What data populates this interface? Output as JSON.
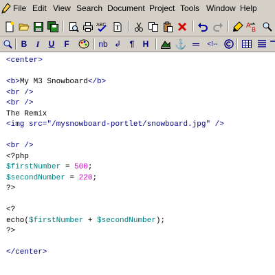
{
  "menu": [
    "File",
    "Edit",
    "View",
    "Search",
    "Document",
    "Project",
    "Tools",
    "Window",
    "Help"
  ],
  "toolbar_icons": [
    "new-file-icon",
    "open-folder-icon",
    "save-icon",
    "save-all-icon",
    "print-preview-icon",
    "print-icon",
    "spellcheck-icon",
    "file-info-icon",
    "cut-icon",
    "copy-icon",
    "paste-icon",
    "delete-icon",
    "undo-icon",
    "redo-icon",
    "highlighter-icon",
    "find-replace-icon",
    "find-icon"
  ],
  "format_toolbar": {
    "bold": "B",
    "italic": "I",
    "underline": "U",
    "font": "F",
    "nbsp": "nb",
    "break": "↲",
    "paragraph": "¶",
    "heading": "H",
    "anchor": "⚓",
    "hr": "═",
    "comment": "<!--"
  },
  "code_lines": [
    {
      "parts": [
        {
          "t": "<center>",
          "c": "tag"
        }
      ]
    },
    {
      "parts": []
    },
    {
      "parts": [
        {
          "t": "<b>",
          "c": "tag"
        },
        {
          "t": "My M3 Snowboard",
          "c": "text"
        },
        {
          "t": "</b>",
          "c": "tag"
        }
      ]
    },
    {
      "parts": [
        {
          "t": "<br />",
          "c": "tag"
        }
      ]
    },
    {
      "parts": [
        {
          "t": "<br />",
          "c": "tag"
        }
      ]
    },
    {
      "parts": [
        {
          "t": "The Remix",
          "c": "text"
        }
      ]
    },
    {
      "parts": [
        {
          "t": "<img src=",
          "c": "tag"
        },
        {
          "t": "\"/mysnowboard-portlet/snowboard.jpg\"",
          "c": "str"
        },
        {
          "t": " />",
          "c": "tag"
        }
      ]
    },
    {
      "parts": []
    },
    {
      "parts": [
        {
          "t": "<br />",
          "c": "tag"
        }
      ]
    },
    {
      "parts": [
        {
          "t": "<?php",
          "c": "php"
        }
      ]
    },
    {
      "parts": [
        {
          "t": "$firstNumber",
          "c": "var"
        },
        {
          "t": " = ",
          "c": "php"
        },
        {
          "t": "500",
          "c": "num"
        },
        {
          "t": ";",
          "c": "php"
        }
      ]
    },
    {
      "parts": [
        {
          "t": "$secondNumber",
          "c": "var"
        },
        {
          "t": " = ",
          "c": "php"
        },
        {
          "t": "220",
          "c": "num"
        },
        {
          "t": ";",
          "c": "php"
        }
      ]
    },
    {
      "parts": [
        {
          "t": "?>",
          "c": "php"
        }
      ]
    },
    {
      "parts": []
    },
    {
      "parts": [
        {
          "t": "<?",
          "c": "php"
        }
      ]
    },
    {
      "parts": [
        {
          "t": "echo(",
          "c": "php"
        },
        {
          "t": "$firstNumber",
          "c": "var"
        },
        {
          "t": " + ",
          "c": "php"
        },
        {
          "t": "$secondNumber",
          "c": "var"
        },
        {
          "t": ");",
          "c": "php"
        }
      ]
    },
    {
      "parts": [
        {
          "t": "?>",
          "c": "php"
        }
      ]
    },
    {
      "parts": []
    },
    {
      "parts": [
        {
          "t": "</center>",
          "c": "tag"
        }
      ]
    }
  ],
  "colors": {
    "tag": "#000080",
    "text": "#000000",
    "var": "#008080",
    "num": "#cc00cc",
    "php": "#000000"
  }
}
